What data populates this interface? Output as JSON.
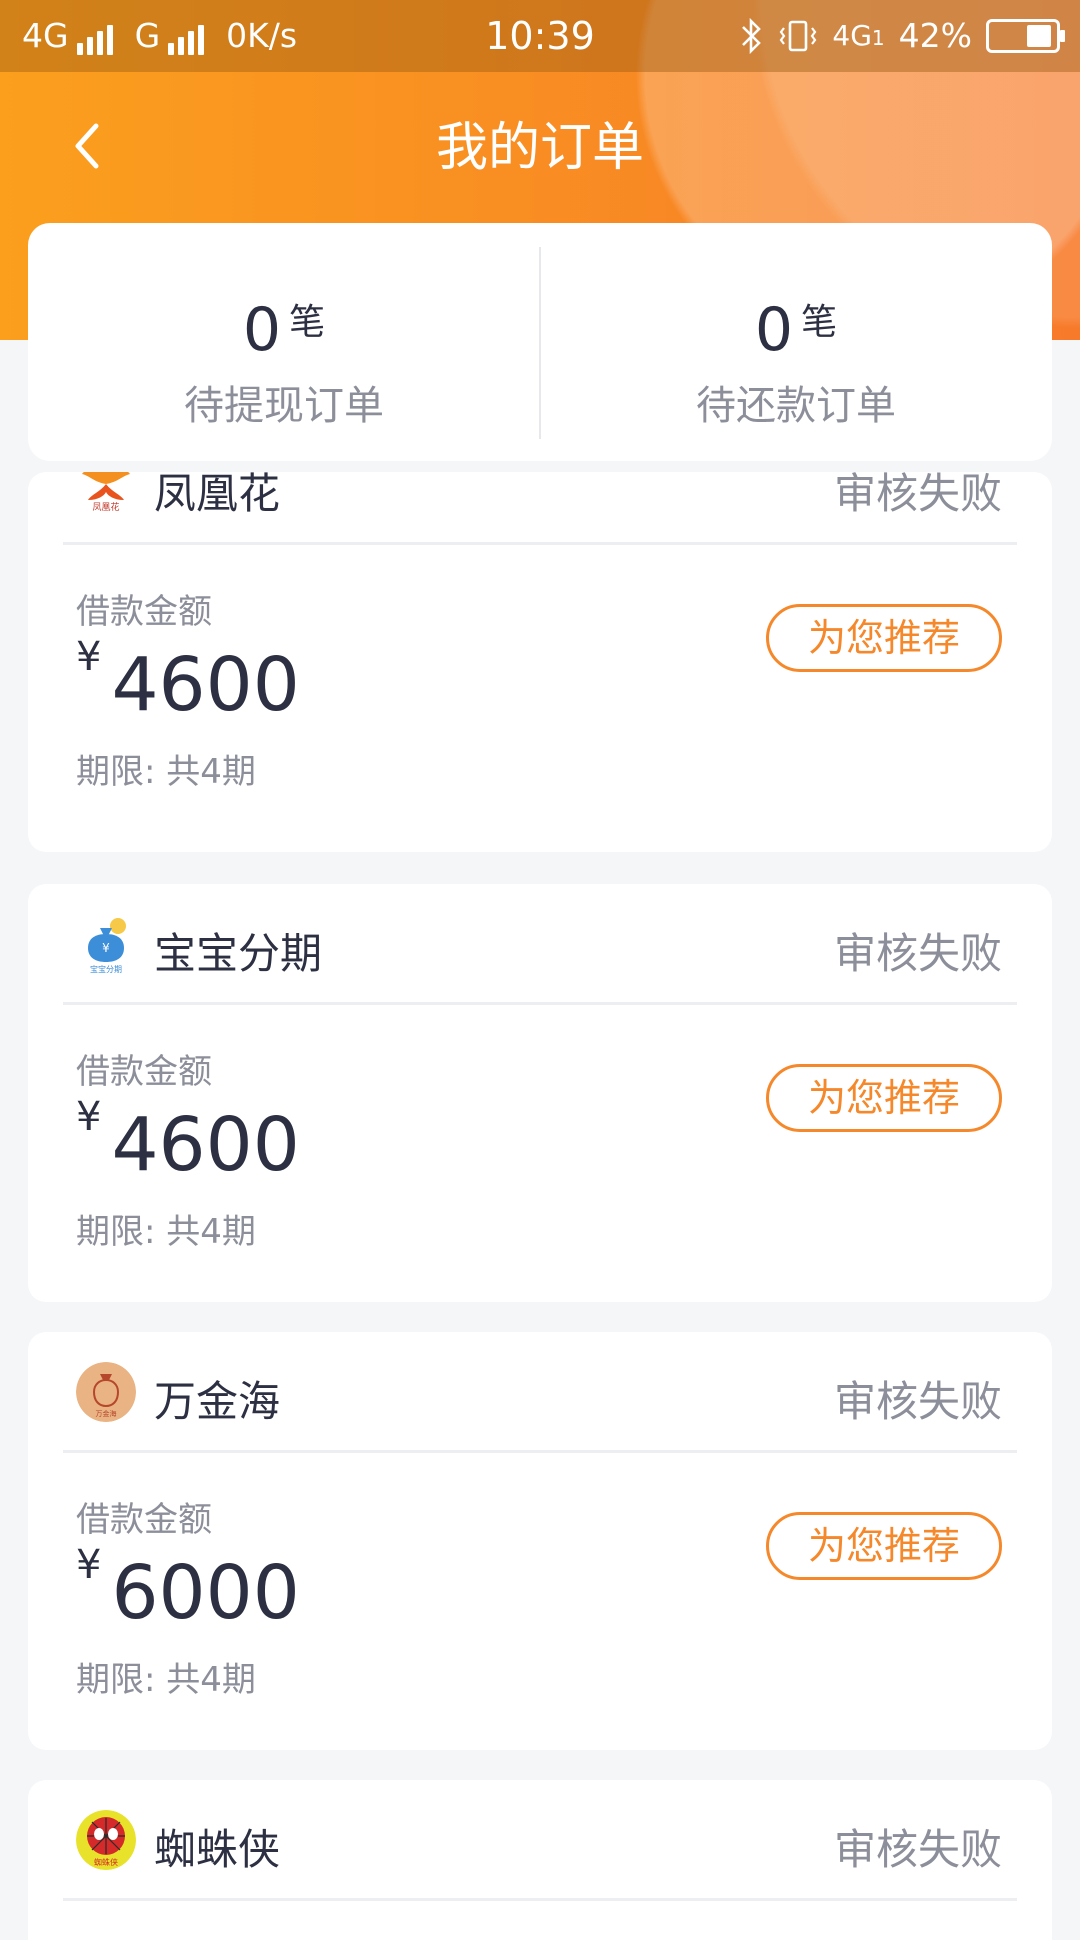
{
  "status_bar": {
    "network_1": "4G",
    "network_2": "G",
    "speed": "0K/s",
    "time": "10:39",
    "network_3": "4G",
    "network_3_sub": "1",
    "battery": "42%"
  },
  "header": {
    "title": "我的订单",
    "back_icon": "chevron-left-icon"
  },
  "summary": {
    "pending_withdraw": {
      "count": "0",
      "unit": "笔",
      "label": "待提现订单"
    },
    "pending_repay": {
      "count": "0",
      "unit": "笔",
      "label": "待还款订单"
    }
  },
  "orders": [
    {
      "merchant": "凤凰花",
      "status": "审核失败",
      "amount_label": "借款金额",
      "currency": "¥",
      "amount": "4600",
      "term": "期限: 共4期",
      "button": "为您推荐",
      "logo_text": "凤凰花"
    },
    {
      "merchant": "宝宝分期",
      "status": "审核失败",
      "amount_label": "借款金额",
      "currency": "¥",
      "amount": "4600",
      "term": "期限: 共4期",
      "button": "为您推荐",
      "logo_text": "宝宝分期"
    },
    {
      "merchant": "万金海",
      "status": "审核失败",
      "amount_label": "借款金额",
      "currency": "¥",
      "amount": "6000",
      "term": "期限: 共4期",
      "button": "为您推荐",
      "logo_text": "万金海"
    },
    {
      "merchant": "蜘蛛侠",
      "status": "审核失败",
      "logo_text": "蜘蛛侠"
    }
  ],
  "colors": {
    "accent": "#f5882b",
    "header_start": "#fb9f1d",
    "header_end": "#f77a2a",
    "text_primary": "#2c3042",
    "text_secondary": "#8c8f9a"
  }
}
